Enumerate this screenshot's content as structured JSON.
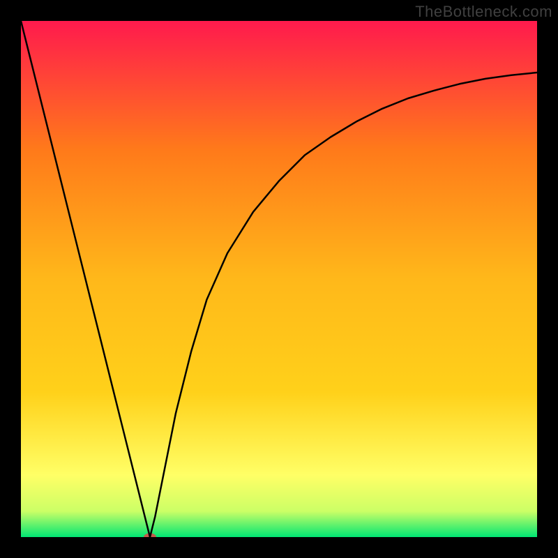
{
  "watermark": "TheBottleneck.com",
  "chart_data": {
    "type": "line",
    "title": "",
    "xlabel": "",
    "ylabel": "",
    "xlim": [
      0,
      100
    ],
    "ylim": [
      0,
      100
    ],
    "axes_visible": false,
    "grid": false,
    "background_gradient": {
      "top": "#ff1a4d",
      "mid_top": "#ff7a1a",
      "mid": "#ffd11a",
      "mid_bottom": "#ffff66",
      "near_bottom": "#ccff66",
      "bottom": "#00e673"
    },
    "series": [
      {
        "name": "bottleneck-curve",
        "stroke": "#000000",
        "stroke_width": 2.5,
        "x": [
          0,
          2,
          4,
          6,
          8,
          10,
          12,
          14,
          16,
          18,
          20,
          22,
          24,
          25,
          26,
          28,
          30,
          33,
          36,
          40,
          45,
          50,
          55,
          60,
          65,
          70,
          75,
          80,
          85,
          90,
          95,
          100
        ],
        "y": [
          100,
          92,
          84,
          76,
          68,
          60,
          52,
          44,
          36,
          28,
          20,
          12,
          4,
          0,
          4,
          14,
          24,
          36,
          46,
          55,
          63,
          69,
          74,
          77.5,
          80.5,
          83,
          85,
          86.5,
          87.8,
          88.8,
          89.5,
          90
        ]
      }
    ],
    "markers": [
      {
        "name": "min-point-marker",
        "x": 25,
        "y": 0,
        "color": "#c4594b",
        "rx": 9,
        "ry": 5.5
      }
    ]
  }
}
